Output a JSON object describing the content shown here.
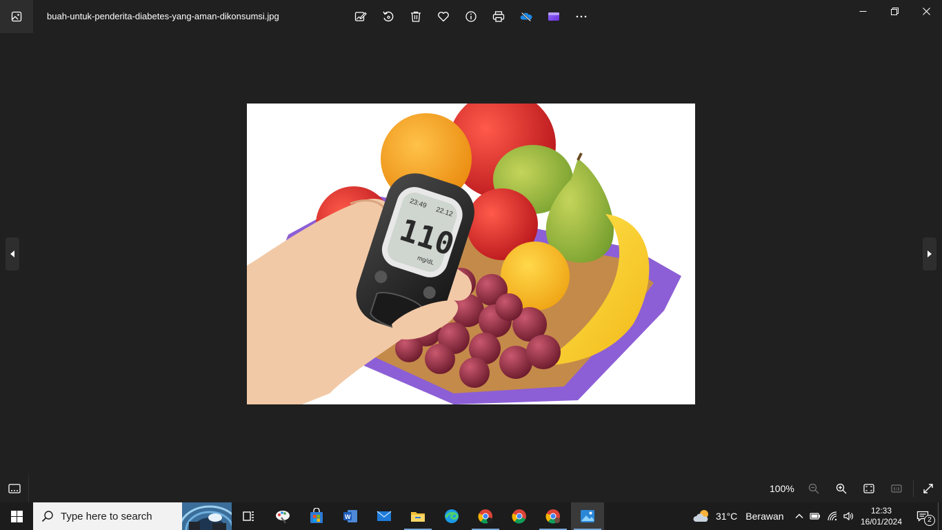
{
  "window": {
    "filename": "buah-untuk-penderita-diabetes-yang-aman-dikonsumsi.jpg",
    "toolbar": [
      "edit-image-icon",
      "rotate-icon",
      "delete-icon",
      "favorite-icon",
      "info-icon",
      "print-icon",
      "onedrive-icon",
      "clipchamp-icon",
      "more-icon"
    ],
    "controls": [
      "minimize-icon",
      "restore-icon",
      "close-icon"
    ]
  },
  "photo": {
    "meter_time": "23:49",
    "meter_date": "22.12",
    "meter_reading": "110",
    "meter_unit": "mg/dL"
  },
  "bottombar": {
    "zoom": "100%"
  },
  "taskbar": {
    "search_placeholder": "Type here to search",
    "weather_temp": "31°C",
    "weather_condition": "Berawan",
    "time": "12:33",
    "date": "16/01/2024",
    "notifications": "2"
  }
}
